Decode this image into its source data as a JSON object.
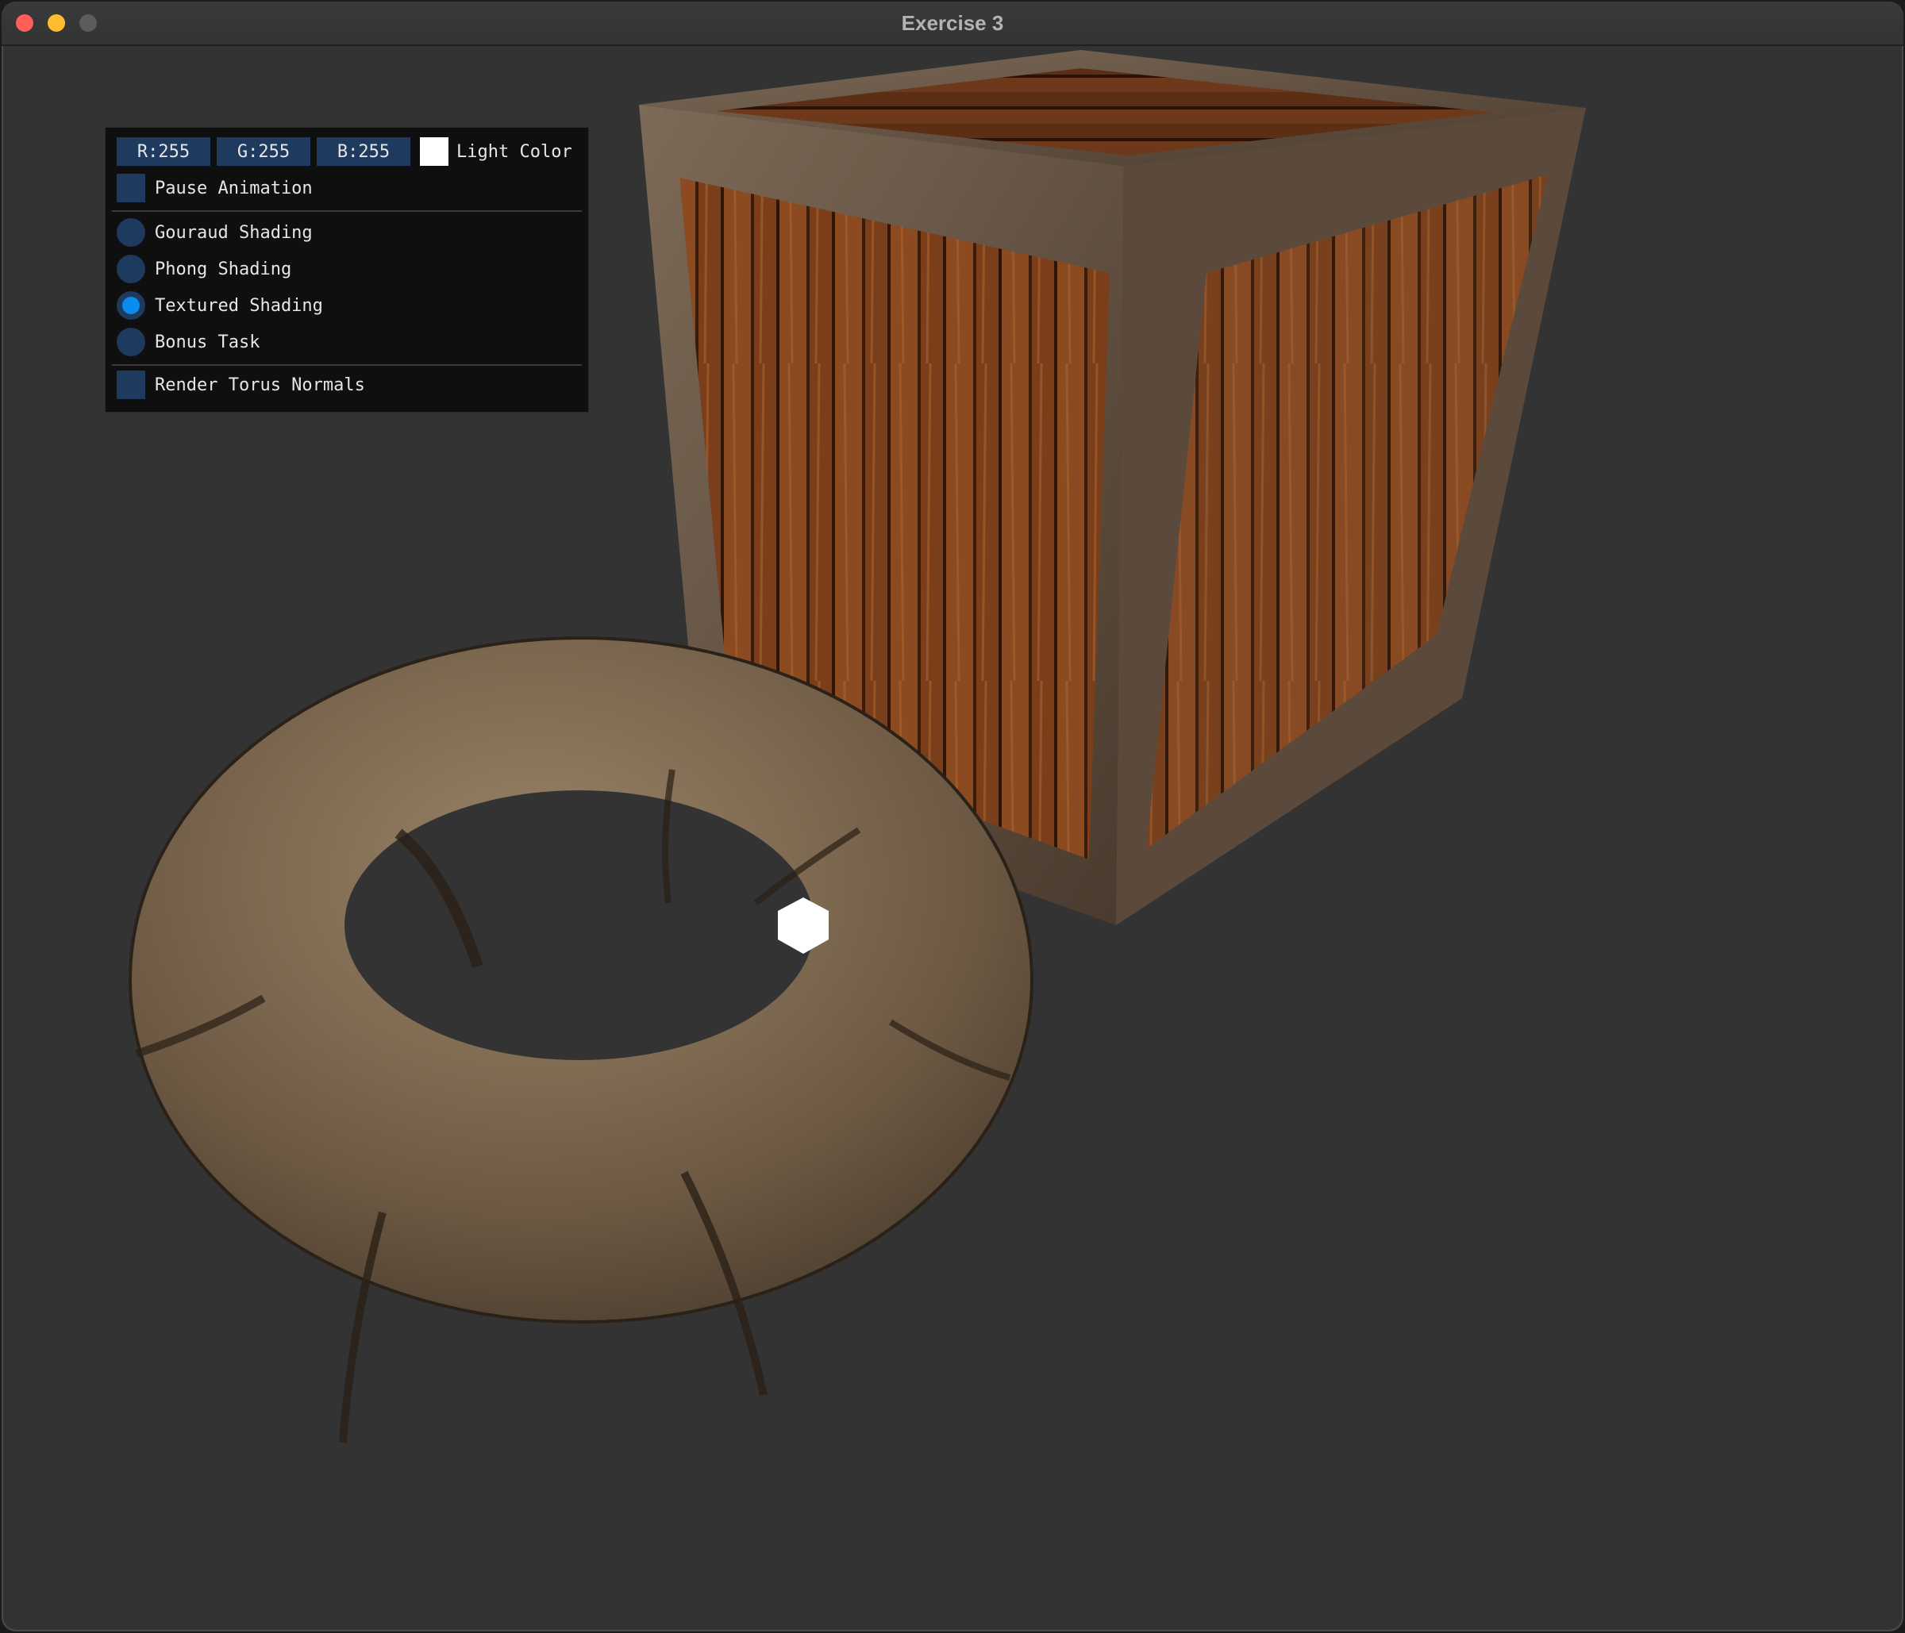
{
  "window": {
    "title": "Exercise 3",
    "traffic_lights": [
      "close",
      "minimize",
      "zoom"
    ]
  },
  "panel": {
    "channels": [
      {
        "label": "R:255"
      },
      {
        "label": "G:255"
      },
      {
        "label": "B:255"
      }
    ],
    "light_color_label": "Light Color",
    "light_color_value": "#ffffff",
    "pause_animation": {
      "label": "Pause Animation",
      "checked": false
    },
    "shading_modes": [
      {
        "label": "Gouraud Shading",
        "selected": false
      },
      {
        "label": "Phong Shading",
        "selected": false
      },
      {
        "label": "Textured Shading",
        "selected": true
      },
      {
        "label": "Bonus Task",
        "selected": false
      }
    ],
    "render_torus_normals": {
      "label": "Render Torus Normals",
      "checked": false
    }
  },
  "scene": {
    "background": "#333333",
    "objects": [
      "wooden-crate",
      "wooden-torus",
      "light-source"
    ]
  }
}
